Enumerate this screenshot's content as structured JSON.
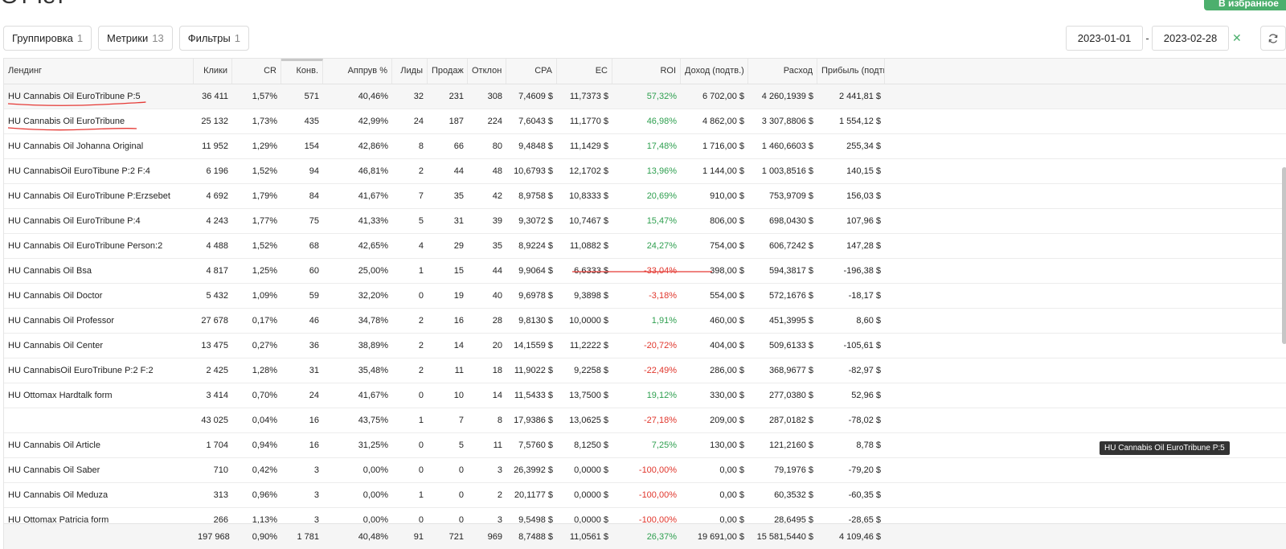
{
  "header": {
    "title": "Отчет",
    "favorite_label": "В избранное"
  },
  "toolbar": {
    "buttons": [
      {
        "label": "Группировка",
        "count": "1"
      },
      {
        "label": "Метрики",
        "count": "13"
      },
      {
        "label": "Фильтры",
        "count": "1"
      }
    ]
  },
  "dates": {
    "from": "2023-01-01",
    "to": "2023-02-28",
    "separator": "-",
    "clear_icon": "close-icon",
    "refresh_icon": "refresh-icon"
  },
  "table": {
    "columns": [
      "Лендинг",
      "Клики",
      "CR",
      "Конв.",
      "Аппрув %",
      "Лиды",
      "Продаж",
      "Отклон",
      "CPA",
      "EC",
      "ROI",
      "Доход (подтв.)",
      "Расход",
      "Прибыль (подтв.)"
    ],
    "sorted_column": "Конв.",
    "rows": [
      [
        "HU Cannabis Oil EuroTribune P:5",
        "36 411",
        "1,57%",
        "571",
        "40,46%",
        "32",
        "231",
        "308",
        "7,4609 $",
        "11,7373 $",
        "57,32%",
        "6 702,00 $",
        "4 260,1939 $",
        "2 441,81 $"
      ],
      [
        "HU Cannabis Oil EuroTribune",
        "25 132",
        "1,73%",
        "435",
        "42,99%",
        "24",
        "187",
        "224",
        "7,6043 $",
        "11,1770 $",
        "46,98%",
        "4 862,00 $",
        "3 307,8806 $",
        "1 554,12 $"
      ],
      [
        "HU Cannabis Oil Johanna Original",
        "11 952",
        "1,29%",
        "154",
        "42,86%",
        "8",
        "66",
        "80",
        "9,4848 $",
        "11,1429 $",
        "17,48%",
        "1 716,00 $",
        "1 460,6603 $",
        "255,34 $"
      ],
      [
        "HU CannabisOil EuroTibune P:2 F:4",
        "6 196",
        "1,52%",
        "94",
        "46,81%",
        "2",
        "44",
        "48",
        "10,6793 $",
        "12,1702 $",
        "13,96%",
        "1 144,00 $",
        "1 003,8516 $",
        "140,15 $"
      ],
      [
        "HU Cannabis Oil EuroTribune P:Erzsebet",
        "4 692",
        "1,79%",
        "84",
        "41,67%",
        "7",
        "35",
        "42",
        "8,9758 $",
        "10,8333 $",
        "20,69%",
        "910,00 $",
        "753,9709 $",
        "156,03 $"
      ],
      [
        "HU Cannabis Oil EuroTribune P:4",
        "4 243",
        "1,77%",
        "75",
        "41,33%",
        "5",
        "31",
        "39",
        "9,3072 $",
        "10,7467 $",
        "15,47%",
        "806,00 $",
        "698,0430 $",
        "107,96 $"
      ],
      [
        "HU Cannabis Oil EuroTribune Person:2",
        "4 488",
        "1,52%",
        "68",
        "42,65%",
        "4",
        "29",
        "35",
        "8,9224 $",
        "11,0882 $",
        "24,27%",
        "754,00 $",
        "606,7242 $",
        "147,28 $"
      ],
      [
        "HU Cannabis Oil Bsa",
        "4 817",
        "1,25%",
        "60",
        "25,00%",
        "1",
        "15",
        "44",
        "9,9064 $",
        "6,6333 $",
        "-33,04%",
        "398,00 $",
        "594,3817 $",
        "-196,38 $"
      ],
      [
        "HU Cannabis Oil Doctor",
        "5 432",
        "1,09%",
        "59",
        "32,20%",
        "0",
        "19",
        "40",
        "9,6978 $",
        "9,3898 $",
        "-3,18%",
        "554,00 $",
        "572,1676 $",
        "-18,17 $"
      ],
      [
        "HU Cannabis Oil Professor",
        "27 678",
        "0,17%",
        "46",
        "34,78%",
        "2",
        "16",
        "28",
        "9,8130 $",
        "10,0000 $",
        "1,91%",
        "460,00 $",
        "451,3995 $",
        "8,60 $"
      ],
      [
        "HU Cannabis Oil Center",
        "13 475",
        "0,27%",
        "36",
        "38,89%",
        "2",
        "14",
        "20",
        "14,1559 $",
        "11,2222 $",
        "-20,72%",
        "404,00 $",
        "509,6133 $",
        "-105,61 $"
      ],
      [
        "HU CannabisOil EuroTribune P:2 F:2",
        "2 425",
        "1,28%",
        "31",
        "35,48%",
        "2",
        "11",
        "18",
        "11,9022 $",
        "9,2258 $",
        "-22,49%",
        "286,00 $",
        "368,9677 $",
        "-82,97 $"
      ],
      [
        "HU Ottomax Hardtalk form",
        "3 414",
        "0,70%",
        "24",
        "41,67%",
        "0",
        "10",
        "14",
        "11,5433 $",
        "13,7500 $",
        "19,12%",
        "330,00 $",
        "277,0380 $",
        "52,96 $"
      ],
      [
        "",
        "43 025",
        "0,04%",
        "16",
        "43,75%",
        "1",
        "7",
        "8",
        "17,9386 $",
        "13,0625 $",
        "-27,18%",
        "209,00 $",
        "287,0182 $",
        "-78,02 $"
      ],
      [
        "HU Cannabis Oil Article",
        "1 704",
        "0,94%",
        "16",
        "31,25%",
        "0",
        "5",
        "11",
        "7,5760 $",
        "8,1250 $",
        "7,25%",
        "130,00 $",
        "121,2160 $",
        "8,78 $"
      ],
      [
        "HU Cannabis Oil Saber",
        "710",
        "0,42%",
        "3",
        "0,00%",
        "0",
        "0",
        "3",
        "26,3992 $",
        "0,0000 $",
        "-100,00%",
        "0,00 $",
        "79,1976 $",
        "-79,20 $"
      ],
      [
        "HU Cannabis Oil Meduza",
        "313",
        "0,96%",
        "3",
        "0,00%",
        "1",
        "0",
        "2",
        "20,1177 $",
        "0,0000 $",
        "-100,00%",
        "0,00 $",
        "60,3532 $",
        "-60,35 $"
      ],
      [
        "HU Ottomax Patricia form",
        "266",
        "1,13%",
        "3",
        "0,00%",
        "0",
        "0",
        "3",
        "9,5498 $",
        "0,0000 $",
        "-100,00%",
        "0,00 $",
        "28,6495 $",
        "-28,65 $"
      ]
    ],
    "totals": [
      "",
      "197 968",
      "0,90%",
      "1 781",
      "40,48%",
      "91",
      "721",
      "969",
      "8,7488 $",
      "11,0561 $",
      "26,37%",
      "19 691,00 $",
      "15 581,5440 $",
      "4 109,46 $"
    ]
  },
  "tooltip": "HU Cannabis Oil EuroTribune P:5",
  "colors": {
    "accent_green": "#4caf6d",
    "positive": "#2e9f4f",
    "negative": "#e0362c",
    "annotation_red": "#e53935"
  }
}
